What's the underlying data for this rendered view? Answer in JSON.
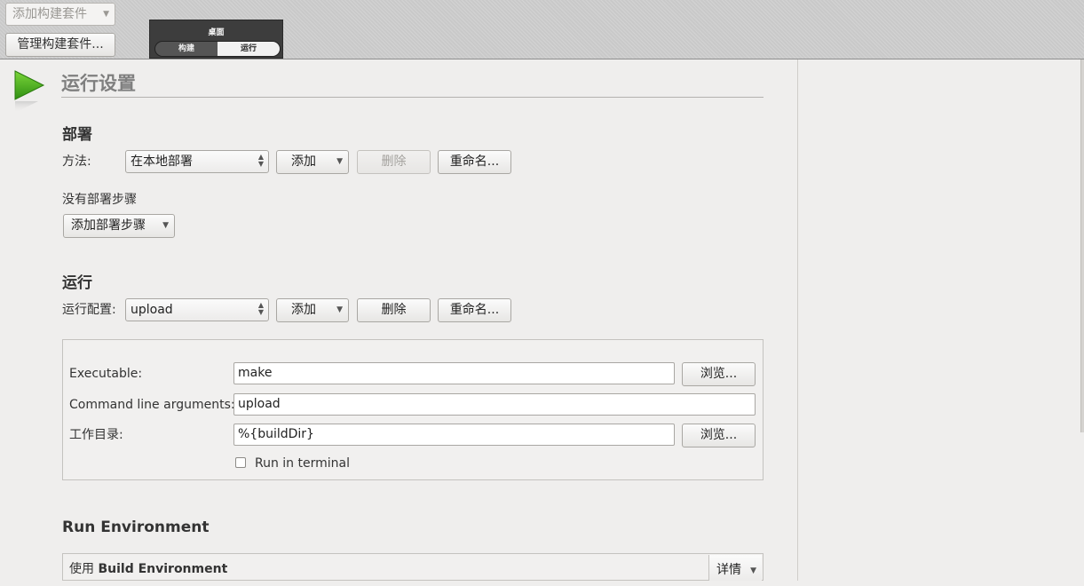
{
  "top": {
    "kit_combo": "添加构建套件",
    "manage_button": "管理构建套件...",
    "mode_title": "桌面",
    "mode_tabs": [
      "构建",
      "运行"
    ]
  },
  "page_title": "运行设置",
  "deploy": {
    "heading": "部署",
    "method_label": "方法:",
    "method_value": "在本地部署",
    "add_label": "添加",
    "delete_label": "删除",
    "rename_label": "重命名...",
    "no_steps_text": "没有部署步骤",
    "add_step_label": "添加部署步骤"
  },
  "run": {
    "heading": "运行",
    "config_label": "运行配置:",
    "config_value": "upload",
    "add_label": "添加",
    "delete_label": "删除",
    "rename_label": "重命名...",
    "executable_label": "Executable:",
    "executable_value": "make",
    "browse_label": "浏览...",
    "args_label": "Command line arguments:",
    "args_value": "upload",
    "workdir_label": "工作目录:",
    "workdir_value": "%{buildDir}",
    "terminal_label": "Run in terminal",
    "terminal_checked": false
  },
  "env": {
    "heading": "Run Environment",
    "use_prefix": "使用",
    "use_value": "Build Environment",
    "details_label": "详情"
  }
}
